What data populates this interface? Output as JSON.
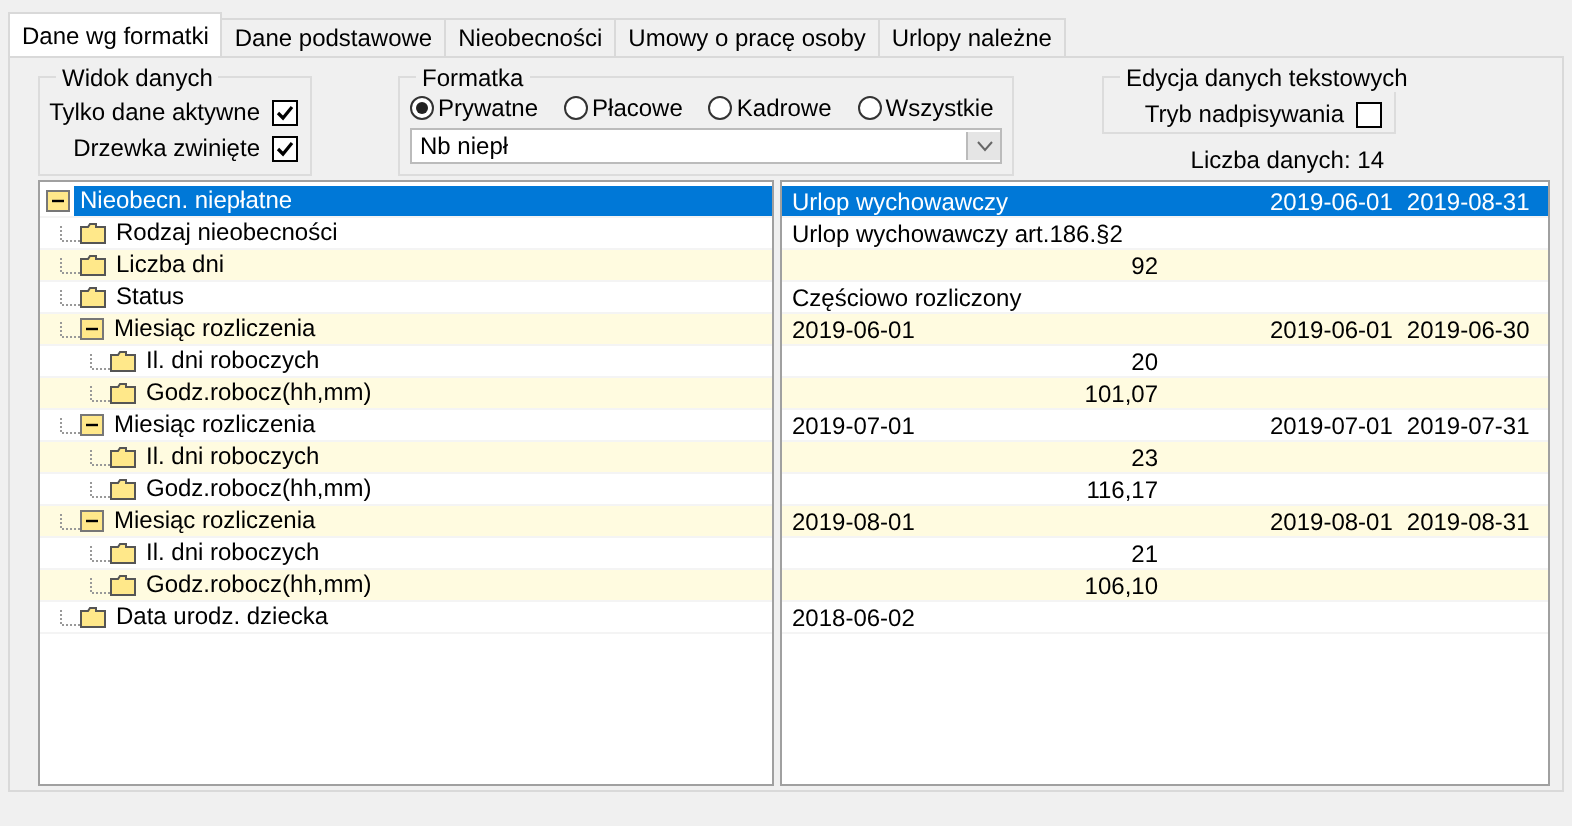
{
  "tabs": [
    {
      "label": "Dane wg formatki",
      "selected": true
    },
    {
      "label": "Dane podstawowe",
      "selected": false
    },
    {
      "label": "Nieobecności",
      "selected": false
    },
    {
      "label": "Umowy o pracę osoby",
      "selected": false
    },
    {
      "label": "Urlopy należne",
      "selected": false
    }
  ],
  "view_group": {
    "title": "Widok danych",
    "options": [
      {
        "label": "Tylko dane aktywne",
        "checked": true
      },
      {
        "label": "Drzewka zwinięte",
        "checked": true
      }
    ]
  },
  "form_group": {
    "title": "Formatka",
    "radios": [
      {
        "label": "Prywatne",
        "selected": true
      },
      {
        "label": "Płacowe",
        "selected": false
      },
      {
        "label": "Kadrowe",
        "selected": false
      },
      {
        "label": "Wszystkie",
        "selected": false
      }
    ],
    "dropdown": {
      "value": "Nb niepł"
    }
  },
  "edit_group": {
    "title": "Edycja danych tekstowych",
    "option": {
      "label": "Tryb nadpisywania",
      "checked": false
    }
  },
  "data_count": "Liczba danych: 14",
  "tree": [
    {
      "label": "Nieobecn. niepłatne",
      "expanded": true,
      "selected": true,
      "children": [
        {
          "label": "Rodzaj nieobecności",
          "selected": false
        },
        {
          "label": "Liczba dni",
          "selected": false
        },
        {
          "label": "Status",
          "selected": false
        },
        {
          "label": "Miesiąc rozliczenia",
          "expanded": true,
          "selected": false,
          "children": [
            {
              "label": "Il. dni roboczych",
              "selected": false
            },
            {
              "label": "Godz.robocz(hh,mm)",
              "selected": false
            }
          ]
        },
        {
          "label": "Miesiąc rozliczenia",
          "expanded": true,
          "selected": false,
          "children": [
            {
              "label": "Il. dni roboczych",
              "selected": false
            },
            {
              "label": "Godz.robocz(hh,mm)",
              "selected": false
            }
          ]
        },
        {
          "label": "Miesiąc rozliczenia",
          "expanded": true,
          "selected": false,
          "children": [
            {
              "label": "Il. dni roboczych",
              "selected": false
            },
            {
              "label": "Godz.robocz(hh,mm)",
              "selected": false
            }
          ]
        },
        {
          "label": "Data urodz. dziecka",
          "selected": false
        }
      ]
    }
  ],
  "grid": [
    {
      "selected": true,
      "kind": "text",
      "value": "Urlop wychowawczy",
      "from": "2019-06-01",
      "to": "2019-08-31"
    },
    {
      "selected": false,
      "kind": "text",
      "value": "Urlop wychowawczy art.186.§2"
    },
    {
      "selected": false,
      "kind": "number",
      "value": "92"
    },
    {
      "selected": false,
      "kind": "text",
      "value": "Częściowo rozliczony"
    },
    {
      "selected": false,
      "kind": "text",
      "value": "2019-06-01",
      "from": "2019-06-01",
      "to": "2019-06-30"
    },
    {
      "selected": false,
      "kind": "number",
      "value": "20"
    },
    {
      "selected": false,
      "kind": "number",
      "value": "101,07"
    },
    {
      "selected": false,
      "kind": "text",
      "value": "2019-07-01",
      "from": "2019-07-01",
      "to": "2019-07-31"
    },
    {
      "selected": false,
      "kind": "number",
      "value": "23"
    },
    {
      "selected": false,
      "kind": "number",
      "value": "116,17"
    },
    {
      "selected": false,
      "kind": "text",
      "value": "2019-08-01",
      "from": "2019-08-01",
      "to": "2019-08-31"
    },
    {
      "selected": false,
      "kind": "number",
      "value": "21"
    },
    {
      "selected": false,
      "kind": "number",
      "value": "106,10"
    },
    {
      "selected": false,
      "kind": "text",
      "value": "2018-06-02"
    }
  ]
}
